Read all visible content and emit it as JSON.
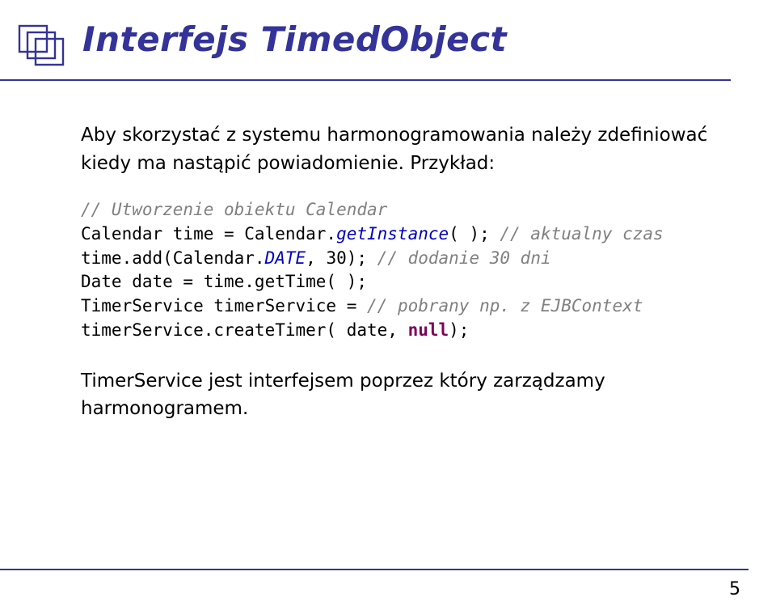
{
  "title": "Interfejs TimedObject",
  "intro": "Aby skorzystać z systemu harmonogramowania należy zdefiniować kiedy ma nastąpić powiadomienie. Przykład:",
  "code": {
    "c1": "// Utworzenie obiektu Calendar",
    "l2a": "Calendar time = Calendar.",
    "l2b": "getInstance",
    "l2c": "( ); ",
    "c2": "// aktualny czas",
    "l3a": "time.add(Calendar.",
    "l3b": "DATE",
    "l3c": ", 30); ",
    "c3": "// dodanie 30 dni",
    "l4": "Date date = time.getTime( );",
    "l5a": "TimerService timerService = ",
    "c5": "// pobrany np. z EJBContext",
    "l6a": "timerService.createTimer( date, ",
    "l6kw": "null",
    "l6b": ");"
  },
  "outro": "TimerService jest interfejsem poprzez który zarządzamy harmonogramem.",
  "page": "5"
}
